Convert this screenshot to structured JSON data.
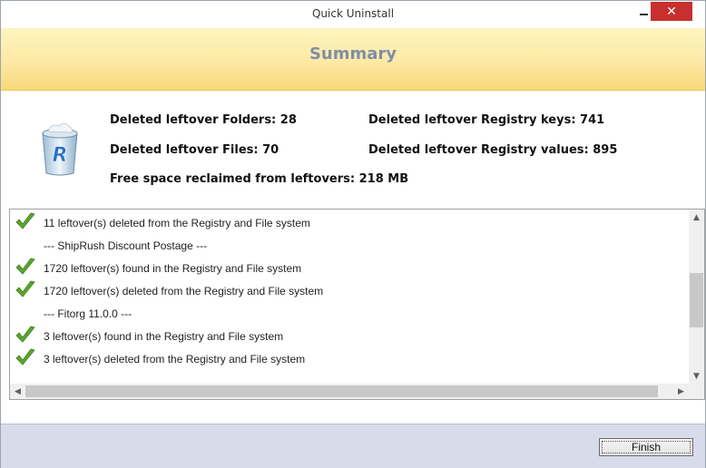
{
  "window": {
    "title": "Quick Uninstall"
  },
  "header": {
    "title": "Summary"
  },
  "stats": {
    "deleted_folders": "Deleted leftover Folders: 28",
    "deleted_files": "Deleted leftover Files: 70",
    "free_space": "Free space reclaimed from leftovers: 218 MB",
    "deleted_registry_keys": "Deleted leftover Registry keys: 741",
    "deleted_registry_values": "Deleted leftover Registry values: 895"
  },
  "log": {
    "items": [
      {
        "text": "11 leftover(s) deleted from the Registry and File system",
        "icon": "check-icon"
      },
      {
        "text": "--- ShipRush Discount Postage ---",
        "icon": ""
      },
      {
        "text": "1720 leftover(s) found in the Registry and File system",
        "icon": "check-icon"
      },
      {
        "text": "1720 leftover(s) deleted from the Registry and File system",
        "icon": "check-icon"
      },
      {
        "text": "--- Fitorg 11.0.0 ---",
        "icon": ""
      },
      {
        "text": "3 leftover(s) found in the Registry and File system",
        "icon": "check-icon"
      },
      {
        "text": "3 leftover(s) deleted from the Registry and File system",
        "icon": "check-icon"
      }
    ]
  },
  "footer": {
    "finish_label": "Finish"
  },
  "colors": {
    "header_title": "#7f8ea6",
    "close_button": "#c7302f",
    "check": "#5aa72c"
  }
}
